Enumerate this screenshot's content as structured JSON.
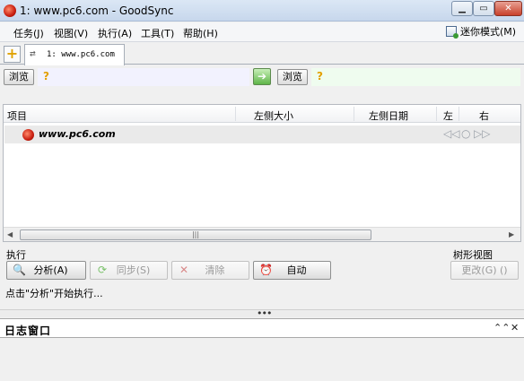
{
  "window": {
    "title": "1: www.pc6.com - GoodSync",
    "minimize": "▁",
    "maximize": "▭",
    "close": "✕"
  },
  "menu": {
    "items": [
      "任务(J)",
      "视图(V)",
      "执行(A)",
      "工具(T)",
      "帮助(H)"
    ],
    "mini_mode": "迷你模式(M)"
  },
  "tabs": {
    "add": "+",
    "active": "1: www.pc6.com"
  },
  "left_panel": {
    "browse": "浏览",
    "status": "?"
  },
  "right_panel": {
    "browse": "浏览",
    "status": "?"
  },
  "direction_arrow": "➔",
  "list": {
    "columns": [
      "项目",
      "左侧大小",
      "左侧日期",
      "左",
      "右"
    ],
    "rows": [
      {
        "name": "www.pc6.com"
      }
    ],
    "row_actions": [
      "◁◁",
      "○",
      "▷▷"
    ]
  },
  "scrollbar": {
    "left": "◀",
    "right": "▶",
    "thumb": "|||"
  },
  "execute": {
    "group_label": "执行",
    "analyze": "分析(A)",
    "sync": "同步(S)",
    "clear": "清除",
    "auto": "自动"
  },
  "tree_view": {
    "label": "树形视图",
    "change": "更改(G) ()"
  },
  "status_message": "点击\"分析\"开始执行...",
  "splitter_grip": "•••",
  "log": {
    "title": "日志窗口",
    "collapse": "⌃⌃",
    "close": "✕"
  },
  "colors": {
    "accent": "#3a78c3",
    "left_path_bg": "#f2f2fe",
    "right_path_bg": "#effcef",
    "sync_green": "#5fb548"
  }
}
